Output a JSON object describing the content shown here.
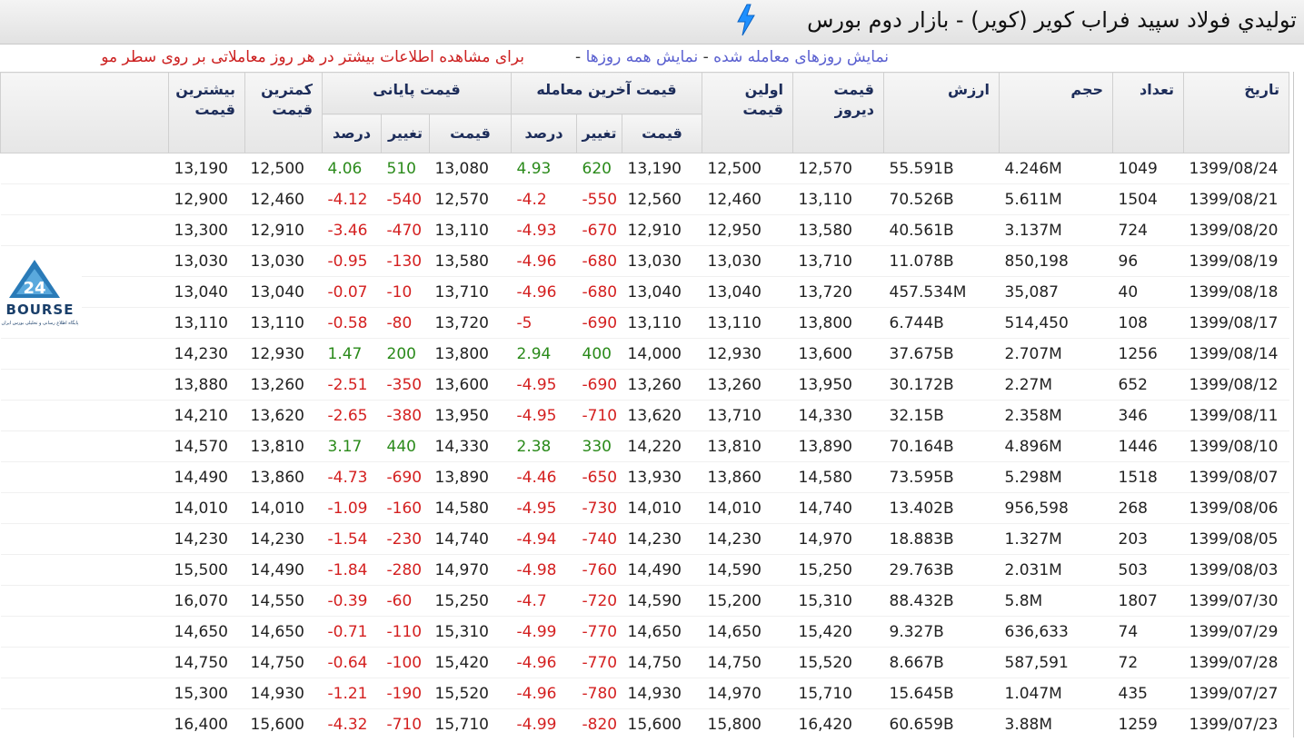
{
  "title": "توليدي فولاد سپيد فراب کوير (کوير) - بازار دوم بورس",
  "subline": {
    "link_traded_days": "نمایش روزهای معامله شده",
    "sep1": " - ",
    "link_all_days": "نمایش همه روزها",
    "sep2": " - ",
    "note": "برای مشاهده اطلاعات بیشتر در هر روز معاملاتی بر روی سطر مو"
  },
  "logo": {
    "text": "BOURSE",
    "mark": "24",
    "caption": "پایگاه اطلاع رسانی و تحلیلی بورس ایران"
  },
  "headers": {
    "date": "تاریخ",
    "count": "تعداد",
    "volume": "حجم",
    "value": "ارزش",
    "yesterday": "قیمت دیروز",
    "first": "اولین قیمت",
    "last_trade_group": "قیمت آخرین معامله",
    "final_group": "قیمت پایانی",
    "price": "قیمت",
    "change": "تغییر",
    "percent": "درصد",
    "low": "کمترین قیمت",
    "high": "بیشترین قیمت"
  },
  "rows": [
    {
      "date": "1399/08/24",
      "count": "1049",
      "volume": "4.246M",
      "value": "55.591B",
      "yesterday": "12,570",
      "first": "12,500",
      "last_price": "13,190",
      "last_change": "620",
      "last_pct": "4.93",
      "final_price": "13,080",
      "final_change": "510",
      "final_pct": "4.06",
      "low": "12,500",
      "high": "13,190"
    },
    {
      "date": "1399/08/21",
      "count": "1504",
      "volume": "5.611M",
      "value": "70.526B",
      "yesterday": "13,110",
      "first": "12,460",
      "last_price": "12,560",
      "last_change": "-550",
      "last_pct": "-4.2",
      "final_price": "12,570",
      "final_change": "-540",
      "final_pct": "-4.12",
      "low": "12,460",
      "high": "12,900"
    },
    {
      "date": "1399/08/20",
      "count": "724",
      "volume": "3.137M",
      "value": "40.561B",
      "yesterday": "13,580",
      "first": "12,950",
      "last_price": "12,910",
      "last_change": "-670",
      "last_pct": "-4.93",
      "final_price": "13,110",
      "final_change": "-470",
      "final_pct": "-3.46",
      "low": "12,910",
      "high": "13,300"
    },
    {
      "date": "1399/08/19",
      "count": "96",
      "volume": "850,198",
      "value": "11.078B",
      "yesterday": "13,710",
      "first": "13,030",
      "last_price": "13,030",
      "last_change": "-680",
      "last_pct": "-4.96",
      "final_price": "13,580",
      "final_change": "-130",
      "final_pct": "-0.95",
      "low": "13,030",
      "high": "13,030"
    },
    {
      "date": "1399/08/18",
      "count": "40",
      "volume": "35,087",
      "value": "457.534M",
      "yesterday": "13,720",
      "first": "13,040",
      "last_price": "13,040",
      "last_change": "-680",
      "last_pct": "-4.96",
      "final_price": "13,710",
      "final_change": "-10",
      "final_pct": "-0.07",
      "low": "13,040",
      "high": "13,040"
    },
    {
      "date": "1399/08/17",
      "count": "108",
      "volume": "514,450",
      "value": "6.744B",
      "yesterday": "13,800",
      "first": "13,110",
      "last_price": "13,110",
      "last_change": "-690",
      "last_pct": "-5",
      "final_price": "13,720",
      "final_change": "-80",
      "final_pct": "-0.58",
      "low": "13,110",
      "high": "13,110"
    },
    {
      "date": "1399/08/14",
      "count": "1256",
      "volume": "2.707M",
      "value": "37.675B",
      "yesterday": "13,600",
      "first": "12,930",
      "last_price": "14,000",
      "last_change": "400",
      "last_pct": "2.94",
      "final_price": "13,800",
      "final_change": "200",
      "final_pct": "1.47",
      "low": "12,930",
      "high": "14,230"
    },
    {
      "date": "1399/08/12",
      "count": "652",
      "volume": "2.27M",
      "value": "30.172B",
      "yesterday": "13,950",
      "first": "13,260",
      "last_price": "13,260",
      "last_change": "-690",
      "last_pct": "-4.95",
      "final_price": "13,600",
      "final_change": "-350",
      "final_pct": "-2.51",
      "low": "13,260",
      "high": "13,880"
    },
    {
      "date": "1399/08/11",
      "count": "346",
      "volume": "2.358M",
      "value": "32.15B",
      "yesterday": "14,330",
      "first": "13,710",
      "last_price": "13,620",
      "last_change": "-710",
      "last_pct": "-4.95",
      "final_price": "13,950",
      "final_change": "-380",
      "final_pct": "-2.65",
      "low": "13,620",
      "high": "14,210"
    },
    {
      "date": "1399/08/10",
      "count": "1446",
      "volume": "4.896M",
      "value": "70.164B",
      "yesterday": "13,890",
      "first": "13,810",
      "last_price": "14,220",
      "last_change": "330",
      "last_pct": "2.38",
      "final_price": "14,330",
      "final_change": "440",
      "final_pct": "3.17",
      "low": "13,810",
      "high": "14,570"
    },
    {
      "date": "1399/08/07",
      "count": "1518",
      "volume": "5.298M",
      "value": "73.595B",
      "yesterday": "14,580",
      "first": "13,860",
      "last_price": "13,930",
      "last_change": "-650",
      "last_pct": "-4.46",
      "final_price": "13,890",
      "final_change": "-690",
      "final_pct": "-4.73",
      "low": "13,860",
      "high": "14,490"
    },
    {
      "date": "1399/08/06",
      "count": "268",
      "volume": "956,598",
      "value": "13.402B",
      "yesterday": "14,740",
      "first": "14,010",
      "last_price": "14,010",
      "last_change": "-730",
      "last_pct": "-4.95",
      "final_price": "14,580",
      "final_change": "-160",
      "final_pct": "-1.09",
      "low": "14,010",
      "high": "14,010"
    },
    {
      "date": "1399/08/05",
      "count": "203",
      "volume": "1.327M",
      "value": "18.883B",
      "yesterday": "14,970",
      "first": "14,230",
      "last_price": "14,230",
      "last_change": "-740",
      "last_pct": "-4.94",
      "final_price": "14,740",
      "final_change": "-230",
      "final_pct": "-1.54",
      "low": "14,230",
      "high": "14,230"
    },
    {
      "date": "1399/08/03",
      "count": "503",
      "volume": "2.031M",
      "value": "29.763B",
      "yesterday": "15,250",
      "first": "14,590",
      "last_price": "14,490",
      "last_change": "-760",
      "last_pct": "-4.98",
      "final_price": "14,970",
      "final_change": "-280",
      "final_pct": "-1.84",
      "low": "14,490",
      "high": "15,500"
    },
    {
      "date": "1399/07/30",
      "count": "1807",
      "volume": "5.8M",
      "value": "88.432B",
      "yesterday": "15,310",
      "first": "15,200",
      "last_price": "14,590",
      "last_change": "-720",
      "last_pct": "-4.7",
      "final_price": "15,250",
      "final_change": "-60",
      "final_pct": "-0.39",
      "low": "14,550",
      "high": "16,070"
    },
    {
      "date": "1399/07/29",
      "count": "74",
      "volume": "636,633",
      "value": "9.327B",
      "yesterday": "15,420",
      "first": "14,650",
      "last_price": "14,650",
      "last_change": "-770",
      "last_pct": "-4.99",
      "final_price": "15,310",
      "final_change": "-110",
      "final_pct": "-0.71",
      "low": "14,650",
      "high": "14,650"
    },
    {
      "date": "1399/07/28",
      "count": "72",
      "volume": "587,591",
      "value": "8.667B",
      "yesterday": "15,520",
      "first": "14,750",
      "last_price": "14,750",
      "last_change": "-770",
      "last_pct": "-4.96",
      "final_price": "15,420",
      "final_change": "-100",
      "final_pct": "-0.64",
      "low": "14,750",
      "high": "14,750"
    },
    {
      "date": "1399/07/27",
      "count": "435",
      "volume": "1.047M",
      "value": "15.645B",
      "yesterday": "15,710",
      "first": "14,970",
      "last_price": "14,930",
      "last_change": "-780",
      "last_pct": "-4.96",
      "final_price": "15,520",
      "final_change": "-190",
      "final_pct": "-1.21",
      "low": "14,930",
      "high": "15,300"
    },
    {
      "date": "1399/07/23",
      "count": "1259",
      "volume": "3.88M",
      "value": "60.659B",
      "yesterday": "16,420",
      "first": "15,800",
      "last_price": "15,600",
      "last_change": "-820",
      "last_pct": "-4.99",
      "final_price": "15,710",
      "final_change": "-710",
      "final_pct": "-4.32",
      "low": "15,600",
      "high": "16,400"
    }
  ],
  "colors": {
    "positive": "#2a8a1a",
    "negative": "#d42020",
    "header_text": "#1d2d5a",
    "link": "#5a60d0",
    "accent_bolt": "#1e90ff"
  }
}
